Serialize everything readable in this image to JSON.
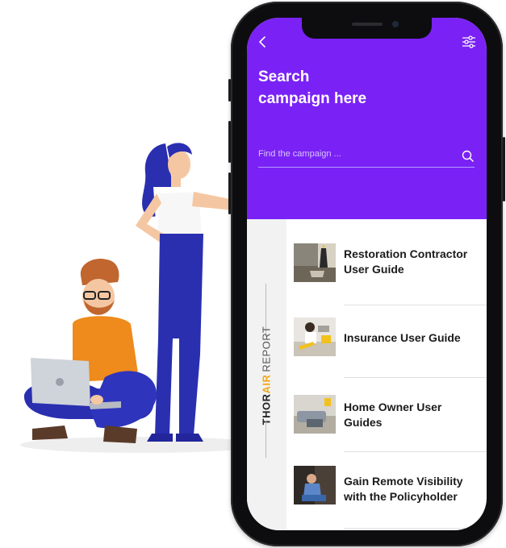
{
  "header": {
    "title_line1": "Search",
    "title_line2": "campaign here",
    "back_icon": "chevron-left-icon",
    "filter_icon": "sliders-icon",
    "bg_color": "#7a22f5"
  },
  "search": {
    "placeholder": "Find the campaign ...",
    "icon": "search-icon"
  },
  "brand": {
    "part1": "THOR",
    "part2": "AIR",
    "part3": "REPORT",
    "accent_color": "#f0a81a"
  },
  "items": [
    {
      "title": "Restoration Contractor User Guide"
    },
    {
      "title": "Insurance User Guide"
    },
    {
      "title": "Home Owner User Guides"
    },
    {
      "title": "Gain Remote Visibility with the Policyholder"
    }
  ]
}
